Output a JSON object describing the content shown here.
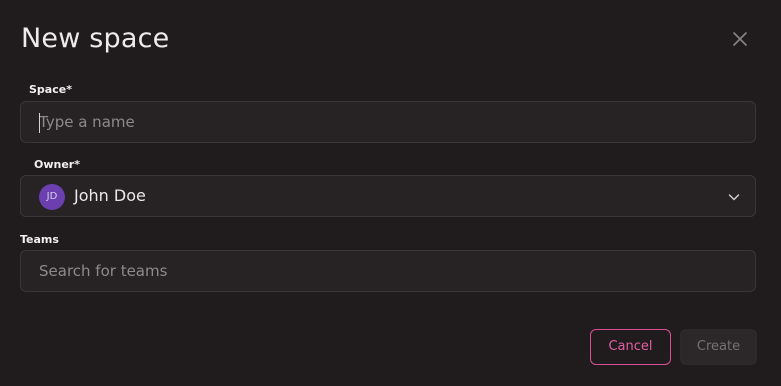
{
  "dialog": {
    "title": "New space",
    "close_icon": "close-icon"
  },
  "space": {
    "label": "Space*",
    "placeholder": "Type a name",
    "value": ""
  },
  "owner": {
    "label": "Owner*",
    "avatar_initials": "JD",
    "avatar_color": "#6b3fb0",
    "name": "John Doe",
    "dropdown_icon": "chevron-down-icon"
  },
  "teams": {
    "label": "Teams",
    "placeholder": "Search for teams",
    "value": ""
  },
  "actions": {
    "cancel_label": "Cancel",
    "create_label": "Create",
    "accent_color": "#e25fa3"
  }
}
